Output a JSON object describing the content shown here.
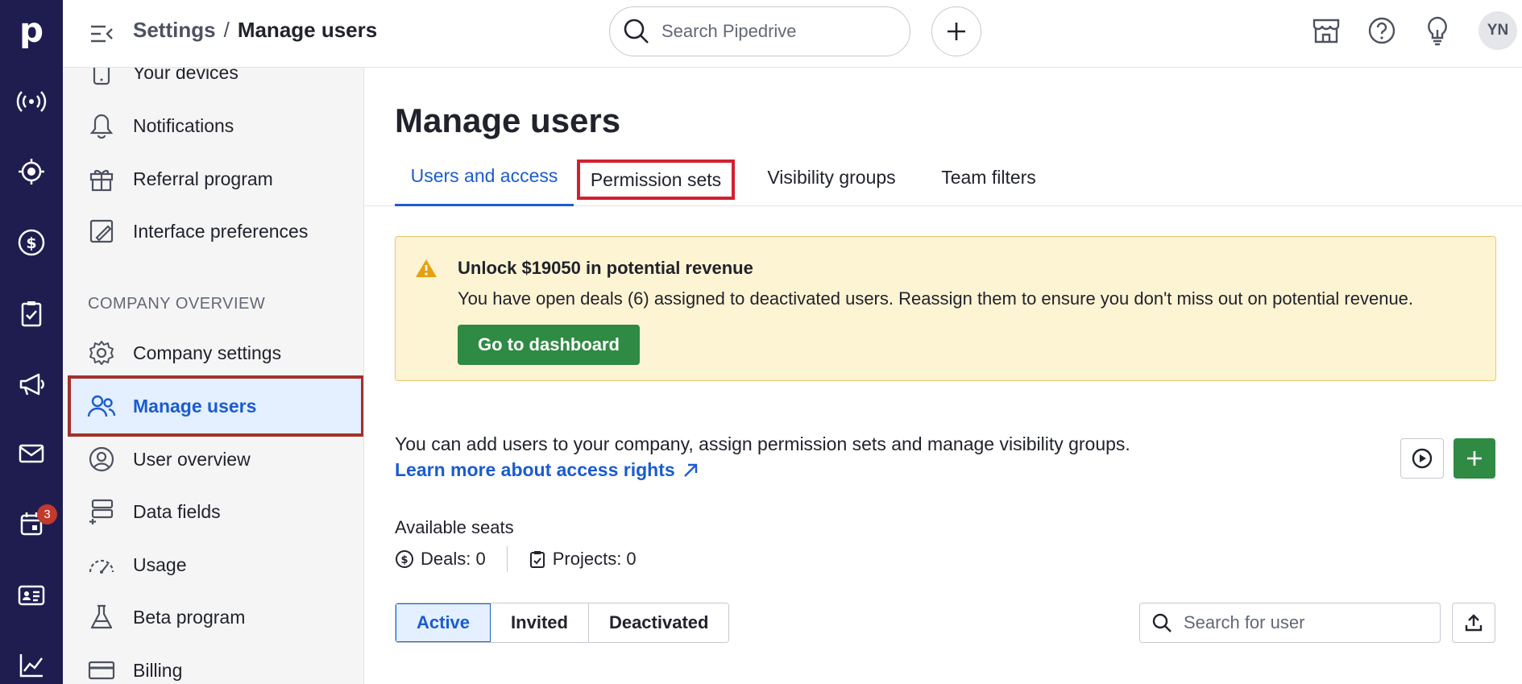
{
  "rail": {
    "logo": "p",
    "calendar_badge": "3",
    "items": [
      "leads-icon",
      "deals-target-icon",
      "revenue-icon",
      "activities-icon",
      "campaigns-icon",
      "mail-icon",
      "calendar-icon",
      "contacts-icon",
      "insights-icon"
    ]
  },
  "topbar": {
    "breadcrumb_parent": "Settings",
    "breadcrumb_sep": "/",
    "breadcrumb_current": "Manage users",
    "search_placeholder": "Search Pipedrive",
    "avatar_initials": "YN"
  },
  "sidebar": {
    "items_top": [
      {
        "label": "Your devices",
        "icon": "device-icon"
      },
      {
        "label": "Notifications",
        "icon": "bell-icon"
      },
      {
        "label": "Referral program",
        "icon": "gift-icon"
      },
      {
        "label": "Interface preferences",
        "icon": "interface-icon"
      }
    ],
    "section_label": "COMPANY OVERVIEW",
    "items_company": [
      {
        "label": "Company settings",
        "icon": "gear-icon"
      },
      {
        "label": "Manage users",
        "icon": "users-icon"
      },
      {
        "label": "User overview",
        "icon": "user-circle-icon"
      },
      {
        "label": "Data fields",
        "icon": "data-fields-icon"
      },
      {
        "label": "Usage",
        "icon": "gauge-icon"
      },
      {
        "label": "Beta program",
        "icon": "flask-icon"
      },
      {
        "label": "Billing",
        "icon": "card-icon"
      }
    ]
  },
  "main": {
    "title": "Manage users",
    "tabs": [
      {
        "label": "Users and access",
        "active": true
      },
      {
        "label": "Permission sets",
        "active": false
      },
      {
        "label": "Visibility groups",
        "active": false
      },
      {
        "label": "Team filters",
        "active": false
      }
    ],
    "alert": {
      "title": "Unlock $19050 in potential revenue",
      "body": "You have open deals (6) assigned to deactivated users. Reassign them to ensure you don't miss out on potential revenue.",
      "button": "Go to dashboard"
    },
    "intro": "You can add users to your company, assign permission sets and manage visibility groups.",
    "learn_link": "Learn more about access rights",
    "seats": {
      "title": "Available seats",
      "deals": "Deals: 0",
      "projects": "Projects: 0"
    },
    "segments": [
      "Active",
      "Invited",
      "Deactivated"
    ],
    "user_search_placeholder": "Search for user"
  },
  "colors": {
    "rail_bg": "#1f1d4f",
    "accent_blue": "#1a5ccf",
    "green": "#2f8a44",
    "alert_bg": "#fdf4d3",
    "highlight_red": "#d2202e"
  }
}
